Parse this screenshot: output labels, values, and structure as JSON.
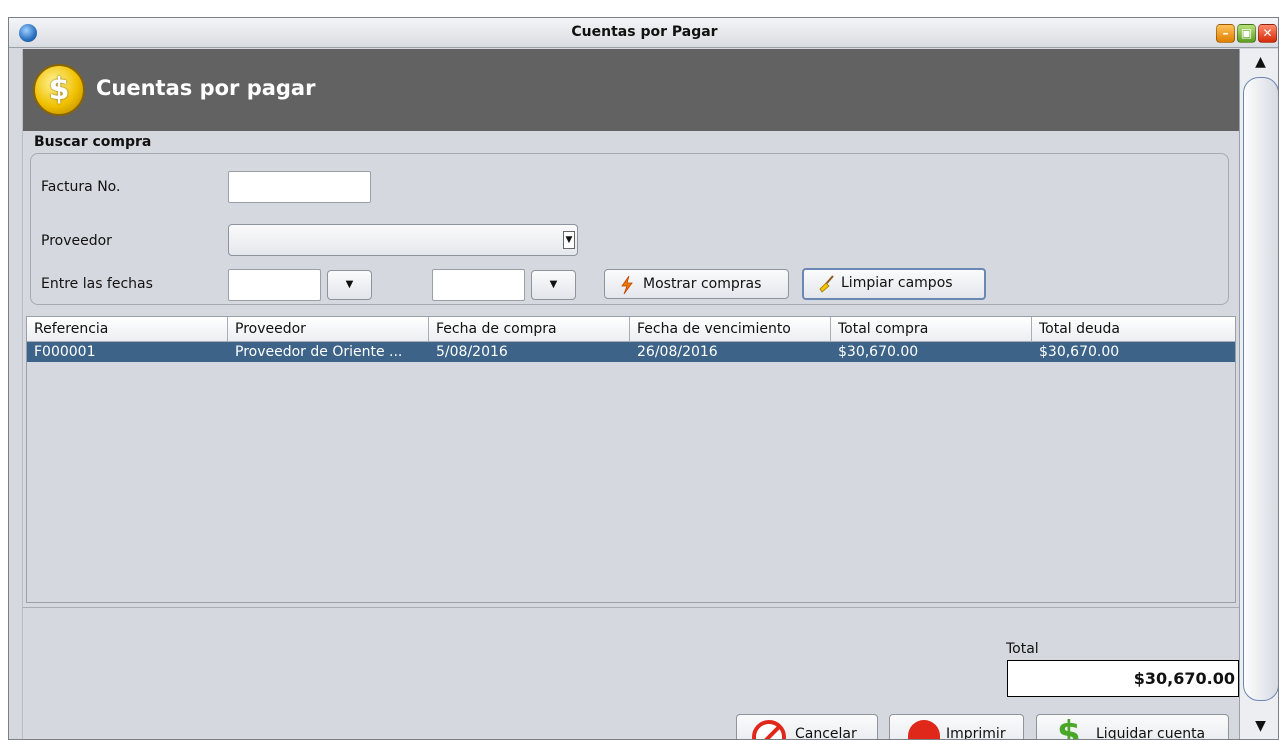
{
  "window": {
    "title": "Cuentas por Pagar",
    "controls": {
      "minimize": "–",
      "maximize": "▣",
      "close": "✕"
    }
  },
  "header": {
    "title": "Cuentas por pagar",
    "icon": "dollar-coin-icon",
    "icon_glyph": "$"
  },
  "search": {
    "group_label": "Buscar compra",
    "factura_label": "Factura No.",
    "factura_value": "",
    "proveedor_label": "Proveedor",
    "proveedor_value": "",
    "fechas_label": "Entre las fechas",
    "fecha_desde": "",
    "fecha_hasta": "",
    "dropdown_glyph": "▼",
    "mostrar_label": "Mostrar compras",
    "limpiar_label": "Limpiar campos"
  },
  "table": {
    "columns": [
      "Referencia",
      "Proveedor",
      "Fecha de compra",
      "Fecha de vencimiento",
      "Total compra",
      "Total deuda"
    ],
    "rows": [
      [
        "F000001",
        "Proveedor de Oriente ...",
        "5/08/2016",
        "26/08/2016",
        "$30,670.00",
        "$30,670.00"
      ]
    ]
  },
  "summary": {
    "total_label": "Total",
    "total_value": "$30,670.00"
  },
  "actions": {
    "cancelar": "Cancelar",
    "imprimir": "Imprimir",
    "liquidar": "Liquidar cuenta"
  },
  "scroll": {
    "up": "▲",
    "down": "▼"
  },
  "colors": {
    "header_band": "#626262",
    "selected_row": "#3d6488",
    "window_bg": "#d5d8de"
  }
}
